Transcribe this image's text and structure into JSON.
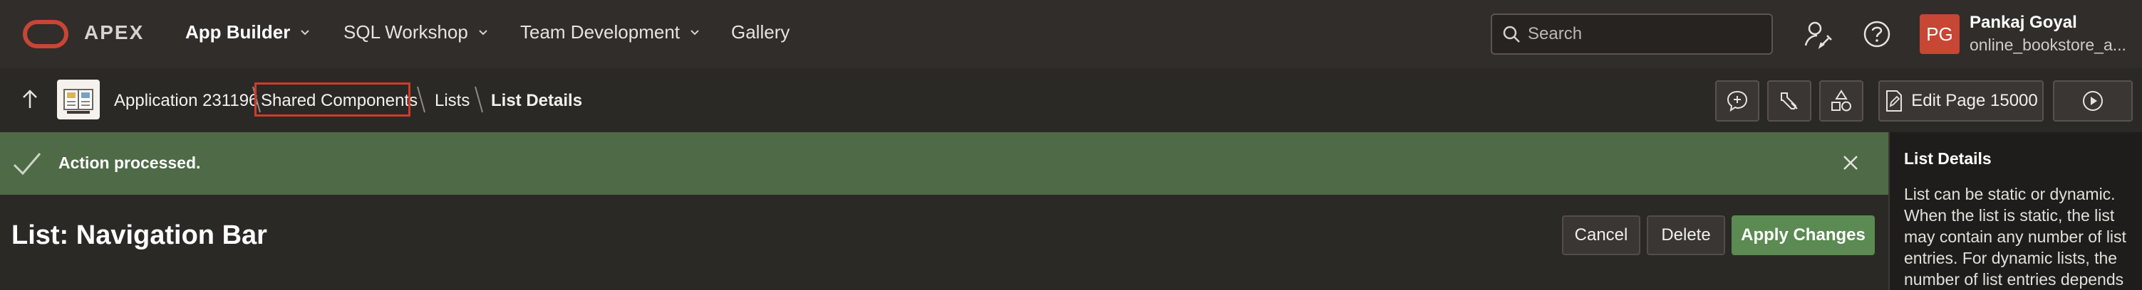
{
  "topbar": {
    "brand": "APEX",
    "nav": [
      {
        "label": "App Builder"
      },
      {
        "label": "SQL Workshop"
      },
      {
        "label": "Team Development"
      },
      {
        "label": "Gallery"
      }
    ],
    "search": {
      "placeholder": "Search"
    },
    "user": {
      "initials": "PG",
      "name": "Pankaj Goyal",
      "workspace": "online_bookstore_a..."
    }
  },
  "breadcrumb": {
    "items": [
      {
        "label": "Application 231196"
      },
      {
        "label": "Shared Components"
      },
      {
        "label": "Lists"
      },
      {
        "label": "List Details"
      }
    ]
  },
  "toolbar": {
    "edit_page_label": "Edit Page 15000"
  },
  "message": {
    "text": "Action processed."
  },
  "page": {
    "title": "List: Navigation Bar",
    "buttons": {
      "cancel": "Cancel",
      "delete": "Delete",
      "apply": "Apply Changes"
    }
  },
  "help": {
    "title": "List Details",
    "body": "List can be static or dynamic. When the list is static, the list may contain any number of list entries. For dynamic lists, the number of list entries depends"
  },
  "colors": {
    "brand_red": "#c74634",
    "success_green": "#4f6a47",
    "primary_button": "#5b8a52",
    "highlight_box": "#d23a2a"
  }
}
